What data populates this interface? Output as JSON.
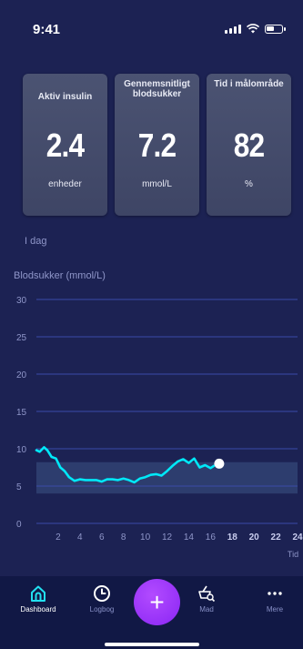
{
  "status_bar": {
    "time": "9:41"
  },
  "stats": {
    "active_insulin": {
      "title": "Aktiv insulin",
      "value": "2.4",
      "unit": "enheder"
    },
    "avg_glucose": {
      "title": "Gennemsnitligt blodsukker",
      "value": "7.2",
      "unit": "mmol/L"
    },
    "time_in_range": {
      "title": "Tid i målområde",
      "value": "82",
      "unit": "%"
    }
  },
  "period_label": "I dag",
  "chart_data": {
    "type": "line",
    "title": "Blodsukker (mmol/L)",
    "xlabel": "Tid",
    "ylabel": "",
    "xlim": [
      0,
      24
    ],
    "ylim": [
      0,
      30
    ],
    "x_ticks": [
      "2",
      "4",
      "6",
      "8",
      "10",
      "12",
      "14",
      "16",
      "18",
      "20",
      "22",
      "24"
    ],
    "y_ticks": [
      "0",
      "5",
      "10",
      "15",
      "20",
      "25",
      "30"
    ],
    "target_range": [
      4.0,
      8.2
    ],
    "series": [
      {
        "x": [
          0,
          0.3,
          0.7,
          1.0,
          1.4,
          1.8,
          2.2,
          2.6,
          3.0,
          3.5,
          4.0,
          4.5,
          5.0,
          5.5,
          6.0,
          6.5,
          7.0,
          7.5,
          8.0,
          8.5,
          9.0,
          9.5,
          10.0,
          10.5,
          11.0,
          11.5,
          12.0,
          12.5,
          13.0,
          13.5,
          14.0,
          14.5,
          15.0,
          15.5,
          16.0,
          16.3
        ],
        "values": [
          9.8,
          9.6,
          10.2,
          9.8,
          8.9,
          8.7,
          7.5,
          7.0,
          6.2,
          5.7,
          5.9,
          5.8,
          5.8,
          5.8,
          5.6,
          5.9,
          5.9,
          5.8,
          6.0,
          5.8,
          5.5,
          6.0,
          6.2,
          6.5,
          6.6,
          6.4,
          7.0,
          7.7,
          8.3,
          8.6,
          8.1,
          8.7,
          7.5,
          7.8,
          7.4,
          7.7
        ],
        "color": "#00e8f8"
      }
    ],
    "current_marker": {
      "x": 16.8,
      "value": 8.0
    }
  },
  "nav": {
    "dashboard": "Dashboard",
    "logbog": "Logbog",
    "add": "+",
    "mad": "Mad",
    "mere": "Mere"
  },
  "colors": {
    "background": "#1c2253",
    "card": "#454c6c",
    "line": "#00e8f8",
    "target_band": "#2d3d6e",
    "accent": "#9b2ff7",
    "nav_bg": "#111845"
  }
}
